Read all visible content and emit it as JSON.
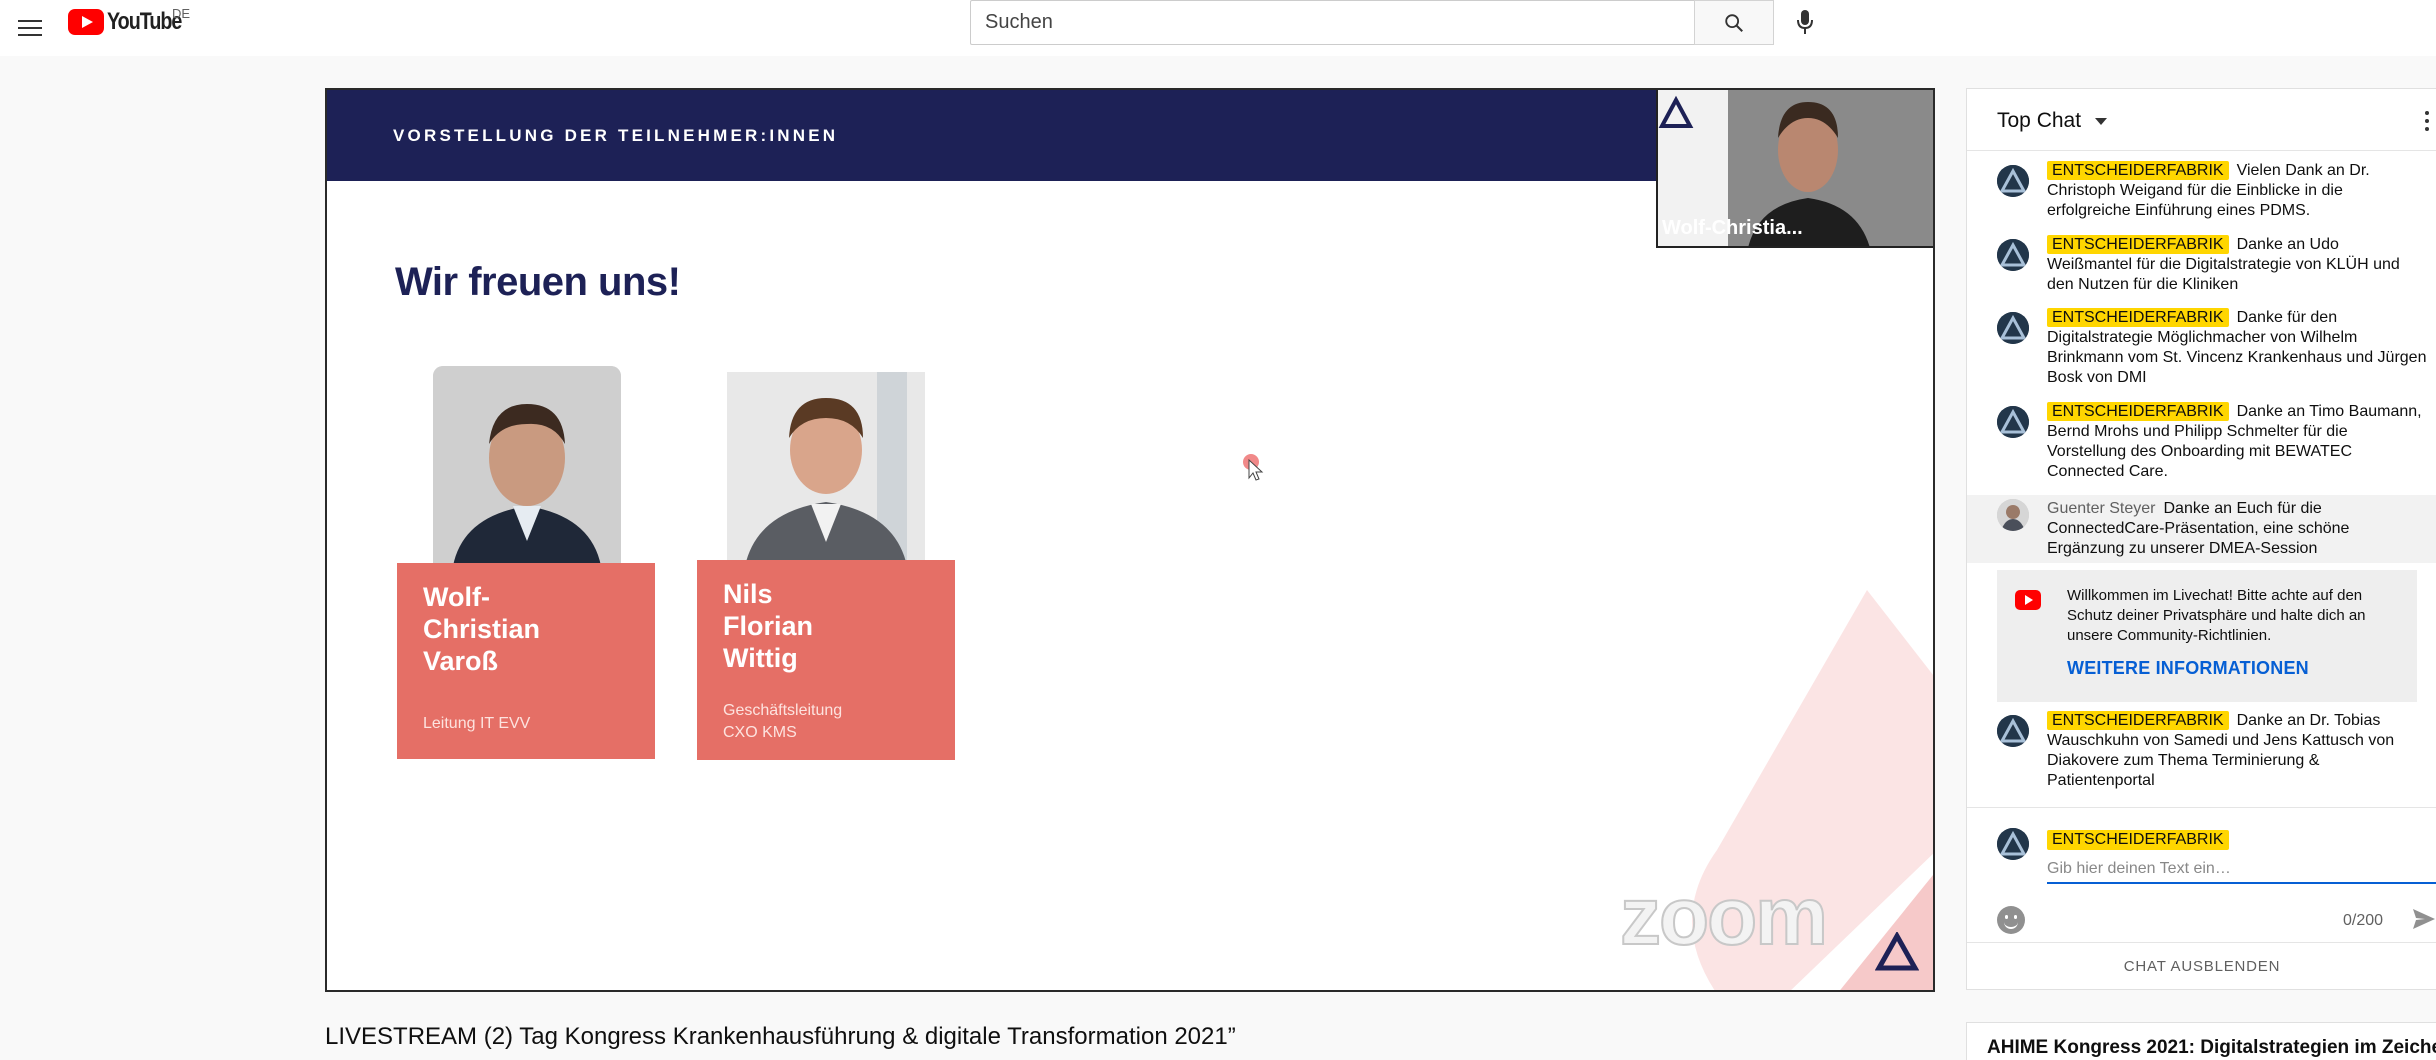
{
  "header": {
    "logo_text": "YouTube",
    "country_code": "DE",
    "search_placeholder": "Suchen"
  },
  "video": {
    "slide_header": "VORSTELLUNG DER TEILNEHMER:INNEN",
    "slide_title": "Wir freuen uns!",
    "participants": [
      {
        "name_lines": [
          "Wolf-",
          "Christian",
          "Varoß"
        ],
        "role_lines": [
          "Leitung IT EVV"
        ]
      },
      {
        "name_lines": [
          "Nils",
          "Florian",
          "Wittig"
        ],
        "role_lines": [
          "Geschäftsleitung",
          "CXO KMS"
        ]
      }
    ],
    "camera_name": "Wolf-Christia...",
    "watermark": "zoom",
    "title": "LIVESTREAM (2) Tag Kongress Krankenhausführung & digitale Transformation 2021”"
  },
  "chat": {
    "header_label": "Top Chat",
    "messages": [
      {
        "author": "ENTSCHEIDERFABRIK",
        "text": "Vielen Dank an Dr. Christoph Weigand für die Einblicke in die erfolgreiche Einführung eines PDMS."
      },
      {
        "author": "ENTSCHEIDERFABRIK",
        "text": "Danke an Udo Weißmantel für die Digitalstrategie von KLÜH und den Nutzen für die Kliniken"
      },
      {
        "author": "ENTSCHEIDERFABRIK",
        "text": "Danke für den Digitalstrategie Möglichmacher von Wilhelm Brinkmann vom St. Vincenz Krankenhaus und Jürgen Bosk von DMI"
      },
      {
        "author": "ENTSCHEIDERFABRIK",
        "text": "Danke an Timo Baumann, Bernd Mrohs und Philipp Schmelter für die Vorstellung des Onboarding mit BEWATEC Connected Care."
      },
      {
        "author": "Guenter Steyer",
        "text": "Danke an Euch für die ConnectedCare-Präsentation, eine schöne Ergänzung zu unserer DMEA-Session"
      },
      {
        "author": "ENTSCHEIDERFABRIK",
        "text": "Danke an Dr. Tobias Wauschkuhn von Samedi und Jens Kattusch von Diakovere zum Thema Terminierung & Patientenportal"
      }
    ],
    "notice_text": "Willkommen im Livechat! Bitte achte auf den Schutz deiner Privatsphäre und halte dich an unsere Community-Richtlinien.",
    "notice_link": "WEITERE INFORMATIONEN",
    "self_author": "ENTSCHEIDERFABRIK",
    "input_placeholder": "Gib hier deinen Text ein…",
    "char_counter": "0/200",
    "hide_label": "CHAT AUSBLENDEN"
  },
  "related": {
    "title": "AHIME Kongress 2021: Digitalstrategien im Zeiche"
  },
  "colors": {
    "brand_red": "#ff0000",
    "slide_navy": "#1d2156",
    "nameplate_coral": "#e56f66",
    "owner_badge": "#ffd600",
    "link_blue": "#065fd4"
  }
}
